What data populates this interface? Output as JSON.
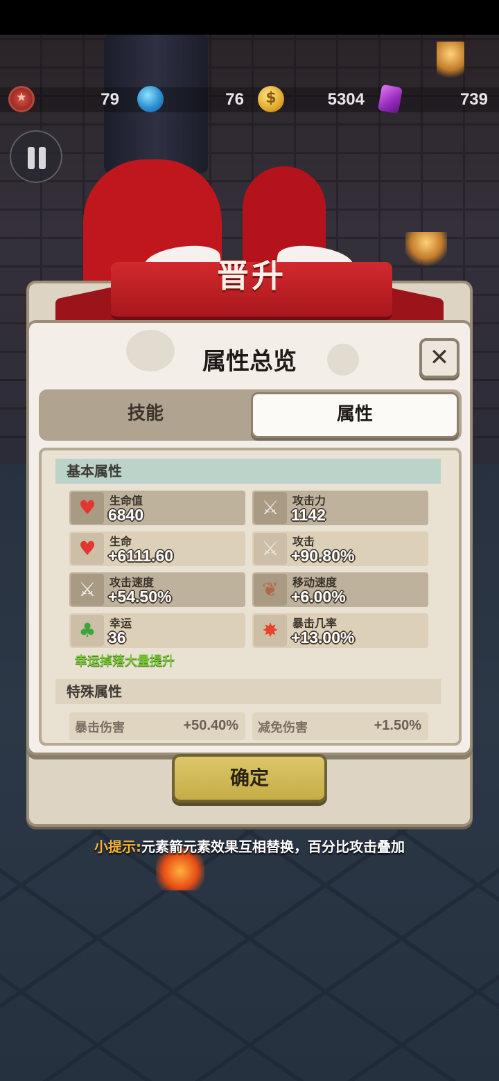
{
  "hud": {
    "resources": [
      {
        "icon": "star-medal-icon",
        "value": "79"
      },
      {
        "icon": "globe-icon",
        "value": "76"
      },
      {
        "icon": "coin-icon",
        "value": "5304"
      },
      {
        "icon": "gem-icon",
        "value": "739"
      }
    ]
  },
  "banner": {
    "title": "晋升"
  },
  "panel": {
    "title": "属性总览",
    "tabs": [
      {
        "label": "技能",
        "active": false
      },
      {
        "label": "属性",
        "active": true
      }
    ],
    "basic": {
      "heading": "基本属性",
      "stats": [
        {
          "label": "生命值",
          "value": "6840",
          "icon": "heart-icon"
        },
        {
          "label": "攻击力",
          "value": "1142",
          "icon": "sword-icon"
        },
        {
          "label": "生命",
          "value": "+6111.60",
          "icon": "heart-up-icon"
        },
        {
          "label": "攻击",
          "value": "+90.80%",
          "icon": "sword-icon"
        },
        {
          "label": "攻击速度",
          "value": "+54.50%",
          "icon": "swift-sword-icon"
        },
        {
          "label": "移动速度",
          "value": "+6.00%",
          "icon": "winged-boot-icon"
        },
        {
          "label": "幸运",
          "value": "36",
          "icon": "clover-icon"
        },
        {
          "label": "暴击几率",
          "value": "+13.00%",
          "icon": "burst-icon"
        }
      ],
      "luck_note": "幸运掉落大量提升"
    },
    "special": {
      "heading": "特殊属性",
      "stats": [
        {
          "label": "暴击伤害",
          "value": "+50.40%"
        },
        {
          "label": "减免伤害",
          "value": "+1.50%"
        }
      ]
    },
    "confirm_label": "确定"
  },
  "tip": {
    "prefix": "小提示:",
    "text": "元素箭元素效果互相替换，百分比攻击叠加"
  },
  "colors": {
    "banner_red": "#c0161e",
    "tab_active": "#fbfaf7",
    "luck_green": "#7ac83a",
    "tip_orange": "#f3b23a",
    "confirm_gold": "#d2bb58"
  }
}
